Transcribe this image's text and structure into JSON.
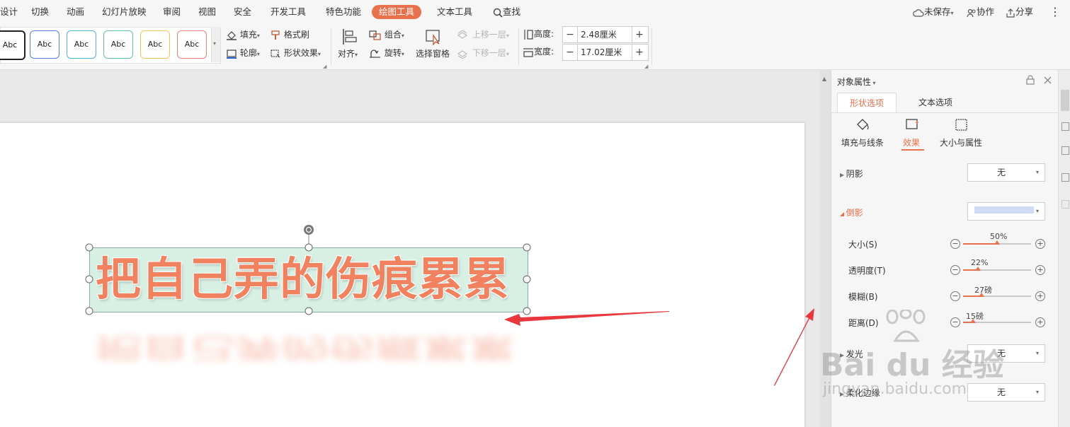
{
  "menu": {
    "tabs": [
      "设计",
      "切换",
      "动画",
      "幻灯片放映",
      "审阅",
      "视图",
      "安全",
      "开发工具",
      "特色功能",
      "绘图工具",
      "文本工具"
    ],
    "search_label": "查找",
    "unsaved_label": "未保存",
    "collab_label": "协作",
    "share_label": "分享"
  },
  "ribbon": {
    "style_samples": [
      "Abc",
      "Abc",
      "Abc",
      "Abc",
      "Abc",
      "Abc"
    ],
    "fill_label": "填充",
    "outline_label": "轮廓",
    "format_painter_label": "格式刷",
    "shape_effects_label": "形状效果",
    "align_label": "对齐",
    "group_label": "组合",
    "rotate_label": "旋转",
    "selection_pane_label": "选择窗格",
    "bring_forward_label": "上移一层",
    "send_backward_label": "下移一层",
    "height_label": "高度:",
    "height_value": "2.48厘米",
    "width_label": "宽度:",
    "width_value": "17.02厘米"
  },
  "slide": {
    "text": "把自己弄的伤痕累累"
  },
  "panel": {
    "title": "对象属性",
    "tabs": [
      "形状选项",
      "文本选项"
    ],
    "subtabs": [
      "填充与线条",
      "效果",
      "大小与属性"
    ],
    "shadow_label": "阴影",
    "shadow_value": "无",
    "reflection_label": "倒影",
    "reflection_color": "#d0dcf4",
    "sliders": [
      {
        "label": "大小(S)",
        "value_text": "50%",
        "fraction": 0.5
      },
      {
        "label": "透明度(T)",
        "value_text": "22%",
        "fraction": 0.22
      },
      {
        "label": "模糊(B)",
        "value_text": "27磅",
        "fraction": 0.27
      },
      {
        "label": "距离(D)",
        "value_text": "15磅",
        "fraction": 0.15
      }
    ],
    "glow_label": "发光",
    "glow_value": "无",
    "soft_edge_label": "柔化边缘",
    "soft_edge_value": "无"
  },
  "watermark": {
    "brand": "Bai du 经验",
    "url": "jingyan.baidu.com"
  },
  "colors": {
    "accent": "#e8704a",
    "text_fill": "#f0825f",
    "selection_fill": "#d8efe4",
    "arrow": "#e8383d"
  }
}
